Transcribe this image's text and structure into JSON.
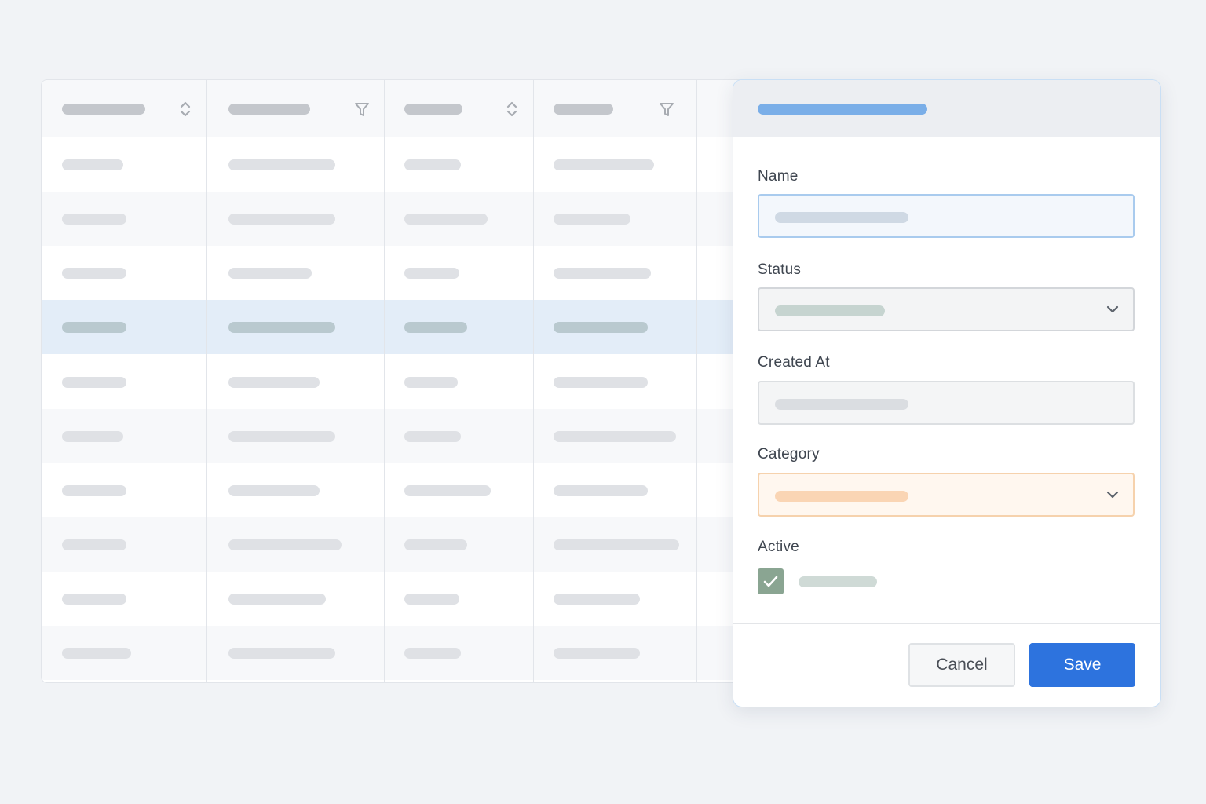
{
  "table": {
    "columns": [
      {
        "header_icon": "sort-icon"
      },
      {
        "header_icon": "filter-icon"
      },
      {
        "header_icon": "sort-icon"
      },
      {
        "header_icon": "filter-icon"
      }
    ],
    "selected_row": 3,
    "row_count": 10
  },
  "form": {
    "fields": {
      "name_label": "Name",
      "status_label": "Status",
      "created_at_label": "Created At",
      "category_label": "Category",
      "active_label": "Active"
    },
    "active_checked": true,
    "status_icon": "chevron-down-icon",
    "category_icon": "chevron-down-icon"
  },
  "buttons": {
    "cancel": "Cancel",
    "save": "Save"
  },
  "colors": {
    "accent": "#2d73de",
    "panel_title_bar": "#7aaee8",
    "category_tint": "#fff7ef",
    "checkbox": "#8aa592",
    "selected_row": "#e3edf8"
  }
}
